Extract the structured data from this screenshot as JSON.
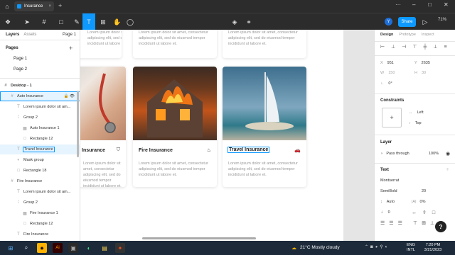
{
  "titlebar": {
    "tab_title": "Insurance"
  },
  "toolbar": {
    "share": "Share",
    "zoom": "71%",
    "avatar_letter": "Y"
  },
  "left_panel": {
    "tabs": [
      "Layers",
      "Assets"
    ],
    "page_selector": "Page 1",
    "pages_header": "Pages",
    "pages": [
      "Page 1",
      "Page 2"
    ],
    "layers": [
      {
        "label": "Desktop - 1",
        "icon": "frame-icon",
        "indent": 0
      },
      {
        "label": "Auto Insurance",
        "icon": "frame-icon",
        "indent": 1
      },
      {
        "label": "Lorem ipsum dolor sit am...",
        "icon": "text-icon",
        "indent": 2
      },
      {
        "label": "Group 2",
        "icon": "group-icon",
        "indent": 2
      },
      {
        "label": "Auto Insurance 1",
        "icon": "image-icon",
        "indent": 3
      },
      {
        "label": "Rectangle 12",
        "icon": "rectangle-icon",
        "indent": 3
      },
      {
        "label": "Travel Insurance",
        "icon": "text-icon",
        "indent": 2
      },
      {
        "label": "Mask group",
        "icon": "mask-icon",
        "indent": 2
      },
      {
        "label": "Rectangle 18",
        "icon": "rectangle-icon",
        "indent": 2
      },
      {
        "label": "Fire Insurance",
        "icon": "frame-icon",
        "indent": 1
      },
      {
        "label": "Lorem ipsum dolor sit am...",
        "icon": "text-icon",
        "indent": 2
      },
      {
        "label": "Group 2",
        "icon": "group-icon",
        "indent": 2
      },
      {
        "label": "Fire Insurance 1",
        "icon": "image-icon",
        "indent": 3
      },
      {
        "label": "Rectangle 12",
        "icon": "rectangle-icon",
        "indent": 3
      },
      {
        "label": "Fire Insurance",
        "icon": "text-icon",
        "indent": 2
      }
    ]
  },
  "canvas": {
    "lorem": "Lorem ipsum dolor sit amet, consectetur adipiscing elit, sed do eiusmod tempor incididunt ut labore et.",
    "cards": [
      {
        "title": "Insurance",
        "icon": "shield-icon"
      },
      {
        "title": "Fire Insurance",
        "icon": "flame-icon"
      },
      {
        "title": "Travel Insurance",
        "icon": "car-icon"
      }
    ]
  },
  "right_panel": {
    "tabs": [
      "Design",
      "Prototype",
      "Inspect"
    ],
    "x_label": "X",
    "x_value": "951",
    "y_label": "Y",
    "y_value": "2635",
    "w_label": "W",
    "w_value": "150",
    "h_label": "H",
    "h_value": "30",
    "rotation": "0°",
    "constraints_header": "Constraints",
    "constraint_h": "Left",
    "constraint_v": "Top",
    "layer_header": "Layer",
    "blend_mode": "Pass through",
    "opacity": "100%",
    "text_header": "Text",
    "font_family": "Montserrat",
    "font_weight": "SemiBold",
    "font_size": "20",
    "line_height": "Auto",
    "letter_spacing": "0%",
    "paragraph_spacing": "0"
  },
  "taskbar": {
    "weather": "21°C Mostly cloudy",
    "lang": "ENG",
    "region": "INTL",
    "time": "7:20 PM",
    "date": "3/21/2023"
  },
  "colors": {
    "accent": "#0d99ff",
    "dark_ui": "#2c2c2c",
    "taskbar": "#1c2a3a"
  }
}
